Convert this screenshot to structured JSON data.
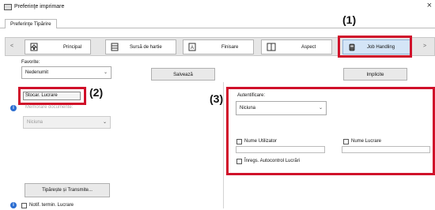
{
  "window": {
    "title": "Preferinţe imprimare",
    "close": "×"
  },
  "tabs": [
    "Preferinţe Tipărire"
  ],
  "toolbar": {
    "buttons": [
      {
        "label": "Principal",
        "icon": "home-icon"
      },
      {
        "label": "Sursă de hartie",
        "icon": "paper-source-icon"
      },
      {
        "label": "Finisare",
        "icon": "finishing-icon"
      },
      {
        "label": "Aspect",
        "icon": "layout-icon"
      },
      {
        "label": "Job Handling",
        "icon": "job-handling-icon"
      }
    ],
    "left_arrow": "<",
    "right_arrow": ">"
  },
  "favorites": {
    "label": "Favorite:",
    "value": "Nedenumit",
    "save": "Salvează",
    "defaults": "Implicite"
  },
  "left": {
    "retain_tab": "Stocar. Lucrare",
    "doc_label": "Memorare documente:",
    "doc_value": "Niciuna",
    "banner_button": "Tipărește și Transmite...",
    "notify_label": "Notif. termin. Lucrare"
  },
  "auth": {
    "label": "Autentificare:",
    "value": "Niciuna",
    "user_name": "Nume Utilizator",
    "job_name": "Nume Lucrare",
    "auditron": "Înregs. Autocontrol Lucrări"
  },
  "callouts": [
    "(1)",
    "(2)",
    "(3)"
  ],
  "colors": {
    "highlight": "#d0102a",
    "active_tab": "#d4e5f7"
  }
}
